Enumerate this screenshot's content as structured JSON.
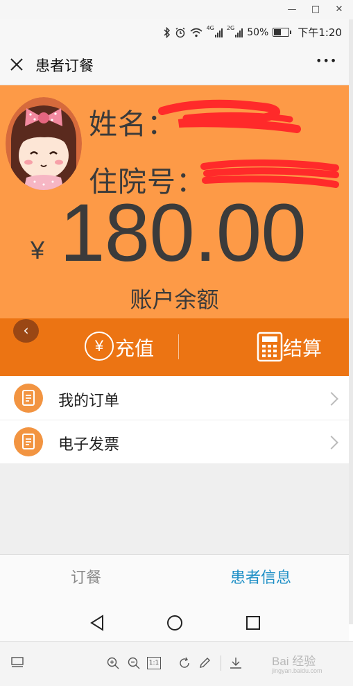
{
  "window": {
    "minimize_glyph": "—",
    "maximize_glyph": "□",
    "close_glyph": "✕"
  },
  "status_bar": {
    "network_4g": "4G",
    "network_2g": "2G",
    "battery": "50%",
    "time": "下午1:20"
  },
  "title_bar": {
    "close_icon": "close-icon",
    "title": "患者订餐",
    "more_glyph": "•••"
  },
  "profile": {
    "name_label": "姓名：",
    "inpatient_no_label": "住院号：",
    "currency_symbol": "¥",
    "balance": "180.00",
    "balance_caption": "账户余额"
  },
  "actions": {
    "back_glyph": "‹",
    "recharge_icon_glyph": "¥",
    "recharge_label": "充值",
    "settle_label": "结算"
  },
  "menu": [
    {
      "label": "我的订单",
      "icon": "document-icon"
    },
    {
      "label": "电子发票",
      "icon": "document-icon"
    }
  ],
  "tabs": [
    {
      "label": "订餐",
      "active": false
    },
    {
      "label": "患者信息",
      "active": true
    }
  ],
  "colors": {
    "header_orange": "#fd9a47",
    "action_orange": "#ec7413",
    "active_tab": "#1e8fc6",
    "inactive_tab": "#8a8a8a",
    "redaction_red": "#ff2a2a"
  },
  "viewer_toolbar": {
    "one_to_one": "1:1",
    "watermark": "Bai 经验",
    "watermark_sub": "jingyan.baidu.com"
  }
}
